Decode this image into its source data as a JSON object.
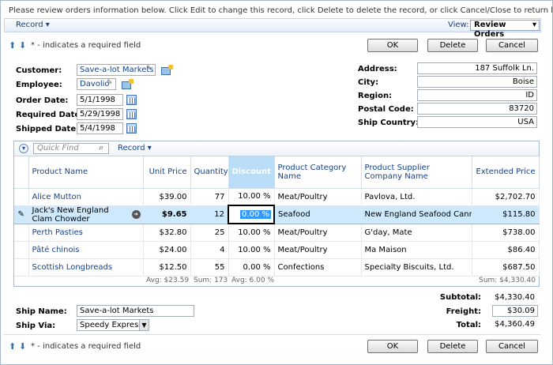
{
  "description": "Please review orders information below. Click Edit to change this record, click Delete to delete the record, or click Cancel/Close to return back.",
  "toolbar": {
    "record_menu": "Record",
    "view_label": "View:",
    "view_value": "Review Orders"
  },
  "required_note": "* - indicates a required field",
  "buttons": {
    "ok": "OK",
    "delete": "Delete",
    "cancel": "Cancel"
  },
  "form": {
    "customer_label": "Customer:",
    "customer_value": "Save-a-lot Markets",
    "employee_label": "Employee:",
    "employee_value": "Davolio",
    "order_date_label": "Order Date:",
    "order_date_value": "5/1/1998",
    "required_date_label": "Required Date:",
    "required_date_value": "5/29/1998",
    "shipped_date_label": "Shipped Date:",
    "shipped_date_value": "5/4/1998",
    "address_label": "Address:",
    "address_value": "187 Suffolk Ln.",
    "city_label": "City:",
    "city_value": "Boise",
    "region_label": "Region:",
    "region_value": "ID",
    "postal_label": "Postal Code:",
    "postal_value": "83720",
    "country_label": "Ship Country:",
    "country_value": "USA"
  },
  "grid": {
    "quick_find_placeholder": "Quick Find",
    "record_menu": "Record",
    "columns": [
      "Product Name",
      "Unit Price",
      "Quantity",
      "Discount",
      "Product Category Name",
      "Product Supplier Company Name",
      "Extended Price"
    ],
    "rows": [
      {
        "name": "Alice Mutton",
        "price": "$39.00",
        "qty": "77",
        "disc": "10.00 %",
        "cat": "Meat/Poultry",
        "supp": "Pavlova, Ltd.",
        "ext": "$2,702.70"
      },
      {
        "name": "Jack's New England Clam Chowder",
        "price": "$9.65",
        "qty": "12",
        "disc": "0.00 %",
        "cat": "Seafood",
        "supp": "New England Seafood Cannery",
        "ext": "$115.80"
      },
      {
        "name": "Perth Pasties",
        "price": "$32.80",
        "qty": "25",
        "disc": "10.00 %",
        "cat": "Meat/Poultry",
        "supp": "G'day, Mate",
        "ext": "$738.00"
      },
      {
        "name": "Pâté chinois",
        "price": "$24.00",
        "qty": "4",
        "disc": "10.00 %",
        "cat": "Meat/Poultry",
        "supp": "Ma Maison",
        "ext": "$86.40"
      },
      {
        "name": "Scottish Longbreads",
        "price": "$12.50",
        "qty": "55",
        "disc": "0.00 %",
        "cat": "Confections",
        "supp": "Specialty Biscuits, Ltd.",
        "ext": "$687.50"
      }
    ],
    "footer": {
      "price": "Avg: $23.59",
      "qty": "Sum: 173",
      "disc": "Avg: 6.00 %",
      "ext": "Sum: $4,330.40"
    }
  },
  "ship": {
    "name_label": "Ship Name:",
    "name_value": "Save-a-lot Markets",
    "via_label": "Ship Via:",
    "via_value": "Speedy Express"
  },
  "totals": {
    "subtotal_label": "Subtotal:",
    "subtotal_value": "$4,330.40",
    "freight_label": "Freight:",
    "freight_value": "$30.09",
    "total_label": "Total:",
    "total_value": "$4,360.49"
  },
  "colors": {
    "accent": "#15428b",
    "selected_row": "#cde9fb",
    "header_selected": "#b9dcf7"
  }
}
